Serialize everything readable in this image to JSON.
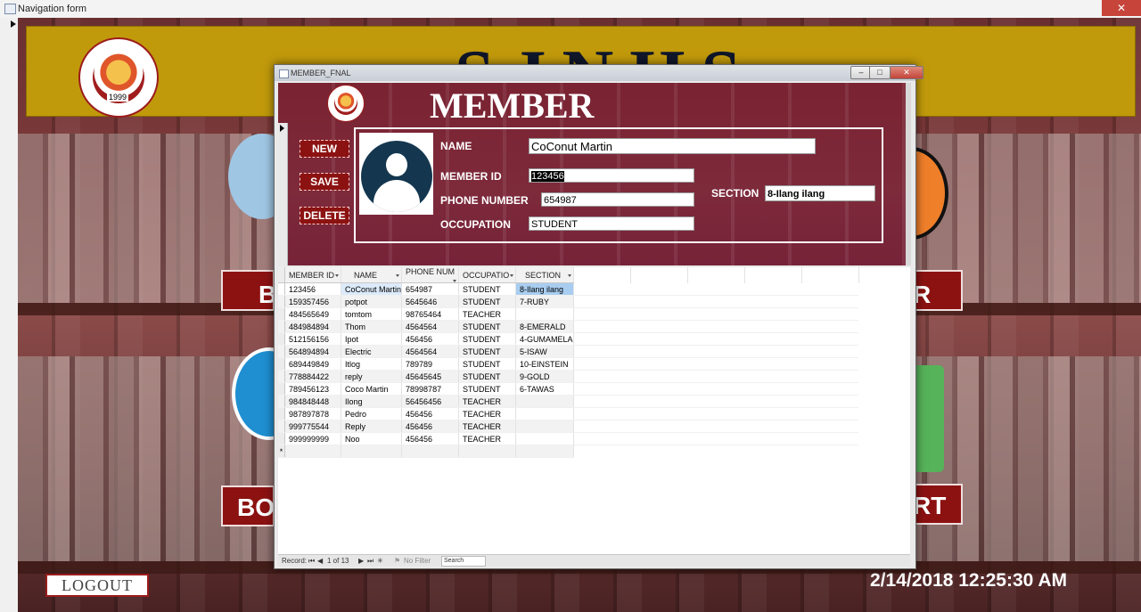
{
  "app": {
    "title": "Navigation form"
  },
  "nav_form": {
    "banner_title": "SJNHS",
    "school_logo_year": "1999",
    "logout_label": "LOGOUT",
    "datetime": "2/14/2018 12:25:30 AM",
    "button_fragments": {
      "top_left": "B",
      "top_right": "R",
      "bottom_left": "BO",
      "bottom_right": "RT"
    }
  },
  "popup": {
    "window_title": "MEMBER_FNAL",
    "window_buttons": {
      "minimize": "–",
      "maximize": "□",
      "close": "✕"
    },
    "form_title": "MEMBER",
    "buttons": {
      "new": "NEW",
      "save": "SAVE",
      "delete": "DELETE"
    },
    "fields": {
      "name_label": "NAME",
      "name_value": "CoConut Martin",
      "member_id_label": "MEMBER ID",
      "member_id_value": "123456",
      "phone_label": "PHONE NUMBER",
      "phone_value": "654987",
      "occupation_label": "OCCUPATION",
      "occupation_value": "STUDENT",
      "section_label": "SECTION",
      "section_value": "8-Ilang ilang"
    },
    "table": {
      "columns": [
        "MEMBER ID",
        "NAME",
        "PHONE NUM",
        "OCCUPATIO",
        "SECTION"
      ],
      "rows": [
        [
          "123456",
          "CoConut Martin",
          "654987",
          "STUDENT",
          "8-Ilang ilang"
        ],
        [
          "159357456",
          "potpot",
          "5645646",
          "STUDENT",
          "7-RUBY"
        ],
        [
          "484565649",
          "tomtom",
          "98765464",
          "TEACHER",
          ""
        ],
        [
          "484984894",
          "Thom",
          "4564564",
          "STUDENT",
          "8-EMERALD"
        ],
        [
          "512156156",
          "Ipot",
          "456456",
          "STUDENT",
          "4-GUMAMELA"
        ],
        [
          "564894894",
          "Electric",
          "4564564",
          "STUDENT",
          "5-ISAW"
        ],
        [
          "689449849",
          "Itlog",
          "789789",
          "STUDENT",
          "10-EINSTEIN"
        ],
        [
          "778884422",
          "reply",
          "45645645",
          "STUDENT",
          "9-GOLD"
        ],
        [
          "789456123",
          "Coco Martin",
          "78998787",
          "STUDENT",
          "6-TAWAS"
        ],
        [
          "984848448",
          "Ilong",
          "56456456",
          "TEACHER",
          ""
        ],
        [
          "987897878",
          "Pedro",
          "456456",
          "TEACHER",
          ""
        ],
        [
          "999775544",
          "Reply",
          "456456",
          "TEACHER",
          ""
        ],
        [
          "999999999",
          "Noo",
          "456456",
          "TEACHER",
          ""
        ]
      ],
      "new_row_marker": "*"
    },
    "status": {
      "record_label": "Record:",
      "position": "1 of 13",
      "filter": "No Filter",
      "search": "Search"
    }
  }
}
